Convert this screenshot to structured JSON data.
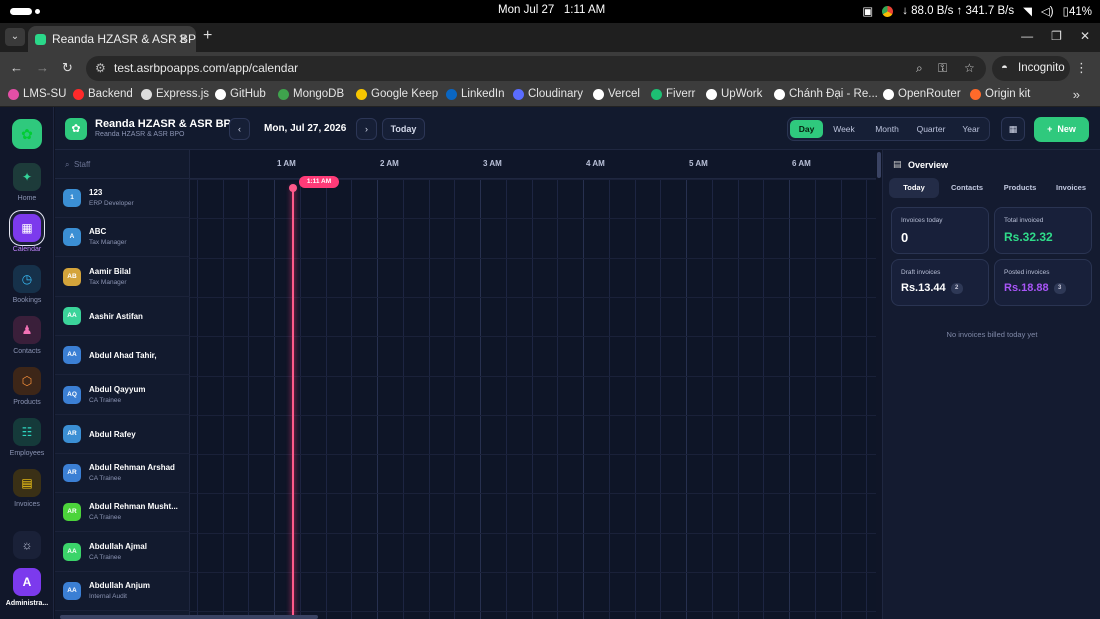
{
  "os": {
    "date": "Mon Jul 27",
    "time": "1:11 AM",
    "net": "↓ 88.0 B/s ↑ 341.7 B/s",
    "battery": "41%"
  },
  "browser": {
    "tab_title": "Reanda HZASR & ASR BP",
    "url": "test.asrbpoapps.com/app/calendar",
    "incognito_label": "Incognito",
    "bookmarks": [
      "LMS-SU",
      "Backend",
      "Express.js",
      "GitHub",
      "MongoDB",
      "Google Keep",
      "LinkedIn",
      "Cloudinary",
      "Vercel",
      "Fiverr",
      "UpWork",
      "Chánh Đại - Re...",
      "OpenRouter",
      "Origin kit"
    ],
    "bookmark_colors": [
      "#e34fa6",
      "#ff2a2a",
      "#dddddd",
      "#ffffff",
      "#3fa34d",
      "#f7c600",
      "#0a66c2",
      "#5a6cff",
      "#ffffff",
      "#1dbf73",
      "#ffffff",
      "#ffffff",
      "#ffffff",
      "#ff6a2a"
    ]
  },
  "rail": {
    "items": [
      {
        "label": "Home",
        "color": "#1d3b3a",
        "icon": "✦",
        "icon_color": "#34d399"
      },
      {
        "label": "Calendar",
        "color": "#7c3aed",
        "icon": "▦",
        "icon_color": "#ffffff",
        "active": true
      },
      {
        "label": "Bookings",
        "color": "#16314a",
        "icon": "◷",
        "icon_color": "#38bdf8"
      },
      {
        "label": "Contacts",
        "color": "#3a1f3a",
        "icon": "♟",
        "icon_color": "#f472b6"
      },
      {
        "label": "Products",
        "color": "#3d2618",
        "icon": "⬡",
        "icon_color": "#fb923c"
      },
      {
        "label": "Employees",
        "color": "#153a3a",
        "icon": "☷",
        "icon_color": "#2dd4bf"
      },
      {
        "label": "Invoices",
        "color": "#3a3016",
        "icon": "▤",
        "icon_color": "#facc15"
      }
    ],
    "settings_icon": "☼",
    "user_initial": "A",
    "user_label": "Administra..."
  },
  "header": {
    "brand": "Reanda HZASR & ASR BPO",
    "brand_sub": "Reanda HZASR & ASR BPO",
    "date": "Mon, Jul 27, 2026",
    "today_label": "Today",
    "views": [
      "Day",
      "Week",
      "Month",
      "Quarter",
      "Year"
    ],
    "active_view": "Day",
    "new_label": "New"
  },
  "staff": {
    "search_placeholder": "Staff",
    "rows": [
      {
        "initials": "1",
        "name": "123",
        "role": "ERP Developer",
        "color": "#3b8fd4"
      },
      {
        "initials": "A",
        "name": "ABC",
        "role": "Tax Manager",
        "color": "#3b8fd4"
      },
      {
        "initials": "AB",
        "name": "Aamir Bilal",
        "role": "Tax Manager",
        "color": "#d4a43b"
      },
      {
        "initials": "AA",
        "name": "Aashir Astifan",
        "role": "",
        "color": "#3bd49a"
      },
      {
        "initials": "AA",
        "name": "Abdul Ahad Tahir,",
        "role": "",
        "color": "#3b7fd4"
      },
      {
        "initials": "AQ",
        "name": "Abdul Qayyum",
        "role": "CA Trainee",
        "color": "#3b7fd4"
      },
      {
        "initials": "AR",
        "name": "Abdul Rafey",
        "role": "",
        "color": "#3b8fd4"
      },
      {
        "initials": "AR",
        "name": "Abdul Rehman Arshad",
        "role": "CA Trainee",
        "color": "#3b7fd4"
      },
      {
        "initials": "AR",
        "name": "Abdul Rehman Musht...",
        "role": "CA Trainee",
        "color": "#4cd43b"
      },
      {
        "initials": "AA",
        "name": "Abdullah Ajmal",
        "role": "CA Trainee",
        "color": "#3bd46a"
      },
      {
        "initials": "AA",
        "name": "Abdullah Anjum",
        "role": "Internal Audit",
        "color": "#3b7fd4"
      }
    ]
  },
  "timeline": {
    "hours": [
      "AM",
      "1 AM",
      "2 AM",
      "3 AM",
      "4 AM",
      "5 AM",
      "6 AM"
    ],
    "now_label": "1:11 AM"
  },
  "overview": {
    "title": "Overview",
    "tabs": [
      "Today",
      "Contacts",
      "Products",
      "Invoices"
    ],
    "active_tab": "Today",
    "cards": [
      {
        "label": "Invoices today",
        "value": "0",
        "color": "#ffffff",
        "badge": ""
      },
      {
        "label": "Total invoiced",
        "value": "Rs.32.32",
        "color": "#2fdc8a",
        "badge": ""
      },
      {
        "label": "Draft invoices",
        "value": "Rs.13.44",
        "color": "#ffffff",
        "badge": "2"
      },
      {
        "label": "Posted invoices",
        "value": "Rs.18.88",
        "color": "#a855f7",
        "badge": "3"
      }
    ],
    "empty_text": "No invoices billed today yet"
  }
}
